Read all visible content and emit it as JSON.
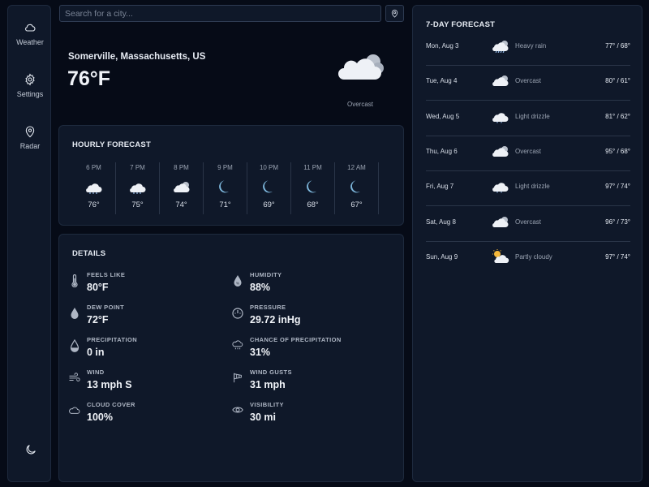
{
  "sidebar": {
    "items": [
      {
        "label": "Weather",
        "icon": "cloud-icon"
      },
      {
        "label": "Settings",
        "icon": "gear-icon"
      },
      {
        "label": "Radar",
        "icon": "map-pin-icon"
      }
    ],
    "theme_icon": "moon-icon"
  },
  "search": {
    "placeholder": "Search for a city...",
    "value": ""
  },
  "current": {
    "city": "Somerville, Massachusetts, US",
    "temp": "76°F",
    "condition": "Overcast",
    "icon": "overcast-icon"
  },
  "hourly": {
    "title": "HOURLY FORECAST",
    "items": [
      {
        "time": "6 PM",
        "temp": "76°",
        "icon": "rain-cloud-icon"
      },
      {
        "time": "7 PM",
        "temp": "75°",
        "icon": "rain-cloud-icon"
      },
      {
        "time": "8 PM",
        "temp": "74°",
        "icon": "overcast-icon"
      },
      {
        "time": "9 PM",
        "temp": "71°",
        "icon": "moon-icon"
      },
      {
        "time": "10 PM",
        "temp": "69°",
        "icon": "moon-icon"
      },
      {
        "time": "11 PM",
        "temp": "68°",
        "icon": "moon-icon"
      },
      {
        "time": "12 AM",
        "temp": "67°",
        "icon": "moon-icon"
      }
    ]
  },
  "details": {
    "title": "DETAILS",
    "items": [
      {
        "label": "FEELS LIKE",
        "value": "80°F",
        "icon": "thermometer-icon"
      },
      {
        "label": "HUMIDITY",
        "value": "88%",
        "icon": "humidity-icon"
      },
      {
        "label": "DEW POINT",
        "value": "72°F",
        "icon": "droplet-icon"
      },
      {
        "label": "PRESSURE",
        "value": "29.72 inHg",
        "icon": "gauge-icon"
      },
      {
        "label": "PRECIPITATION",
        "value": "0 in",
        "icon": "rain-gauge-icon"
      },
      {
        "label": "CHANCE OF PRECIPITATION",
        "value": "31%",
        "icon": "rain-chance-icon"
      },
      {
        "label": "WIND",
        "value": "13 mph S",
        "icon": "wind-icon"
      },
      {
        "label": "WIND GUSTS",
        "value": "31 mph",
        "icon": "windsock-icon"
      },
      {
        "label": "CLOUD COVER",
        "value": "100%",
        "icon": "cloud-cover-icon"
      },
      {
        "label": "VISIBILITY",
        "value": "30 mi",
        "icon": "eye-icon"
      }
    ]
  },
  "forecast": {
    "title": "7-DAY FORECAST",
    "days": [
      {
        "date": "Mon, Aug 3",
        "condition": "Heavy rain",
        "temp": "77° / 68°",
        "icon": "heavy-rain-icon"
      },
      {
        "date": "Tue, Aug 4",
        "condition": "Overcast",
        "temp": "80° / 61°",
        "icon": "overcast-icon"
      },
      {
        "date": "Wed, Aug 5",
        "condition": "Light drizzle",
        "temp": "81° / 62°",
        "icon": "drizzle-icon"
      },
      {
        "date": "Thu, Aug 6",
        "condition": "Overcast",
        "temp": "95° / 68°",
        "icon": "overcast-icon"
      },
      {
        "date": "Fri, Aug 7",
        "condition": "Light drizzle",
        "temp": "97° / 74°",
        "icon": "drizzle-icon"
      },
      {
        "date": "Sat, Aug 8",
        "condition": "Overcast",
        "temp": "96° / 73°",
        "icon": "overcast-icon"
      },
      {
        "date": "Sun, Aug 9",
        "condition": "Partly cloudy",
        "temp": "97° / 74°",
        "icon": "partly-cloudy-icon"
      }
    ]
  },
  "colors": {
    "background": "#060b17",
    "panel": "#0f1829",
    "moon": "#7eb8dd",
    "cloud": "#eef1f6",
    "sun": "#f5b83a"
  }
}
